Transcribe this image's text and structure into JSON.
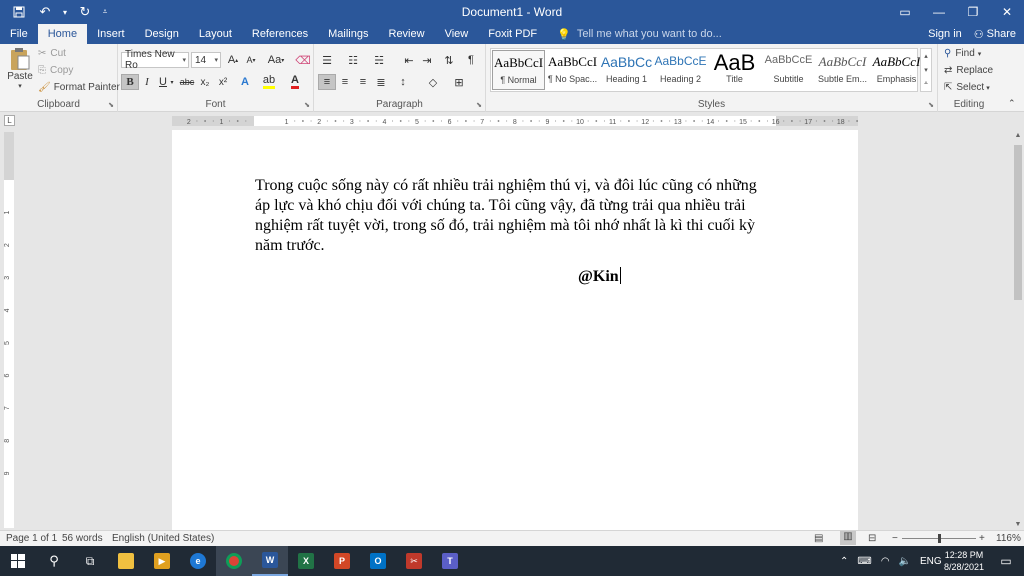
{
  "window": {
    "title": "Document1 - Word",
    "controls": {
      "ribbon_display": "▭",
      "minimize": "—",
      "restore": "❐",
      "close": "✕"
    }
  },
  "qat": {
    "save": "save-icon",
    "undo": "undo-icon",
    "redo": "repeat-icon"
  },
  "tabs": [
    {
      "label": "File",
      "active": false
    },
    {
      "label": "Home",
      "active": true
    },
    {
      "label": "Insert",
      "active": false
    },
    {
      "label": "Design",
      "active": false
    },
    {
      "label": "Layout",
      "active": false
    },
    {
      "label": "References",
      "active": false
    },
    {
      "label": "Mailings",
      "active": false
    },
    {
      "label": "Review",
      "active": false
    },
    {
      "label": "View",
      "active": false
    },
    {
      "label": "Foxit PDF",
      "active": false
    }
  ],
  "tellme": {
    "text": "Tell me what you want to do..."
  },
  "account": {
    "sign_in": "Sign in",
    "share": "Share"
  },
  "clipboard": {
    "paste": "Paste",
    "cut": "Cut",
    "copy": "Copy",
    "format_painter": "Format Painter",
    "label": "Clipboard"
  },
  "font": {
    "name": "Times New Ro",
    "size": "14",
    "grow": "A",
    "shrink": "A",
    "case": "Aa",
    "bold": "B",
    "italic": "I",
    "underline": "U",
    "strike": "abc",
    "sub": "x₂",
    "sup": "x²",
    "label": "Font"
  },
  "paragraph": {
    "label": "Paragraph",
    "show_marks": "¶"
  },
  "styles": {
    "label": "Styles",
    "items": [
      {
        "sample": "AaBbCcI",
        "name": "¶ Normal"
      },
      {
        "sample": "AaBbCcI",
        "name": "¶ No Spac..."
      },
      {
        "sample": "AaBbCc",
        "name": "Heading 1"
      },
      {
        "sample": "AaBbCcE",
        "name": "Heading 2"
      },
      {
        "sample": "AaB",
        "name": "Title"
      },
      {
        "sample": "AaBbCcE",
        "name": "Subtitle"
      },
      {
        "sample": "AaBbCcI",
        "name": "Subtle Em..."
      },
      {
        "sample": "AaBbCcI",
        "name": "Emphasis"
      }
    ]
  },
  "editing": {
    "find": "Find",
    "replace": "Replace",
    "select": "Select",
    "label": "Editing"
  },
  "ruler": {
    "h_labels": [
      "2",
      "1",
      "1",
      "2",
      "3",
      "4",
      "5",
      "6",
      "7",
      "8",
      "9",
      "10",
      "11",
      "12",
      "13",
      "14",
      "15",
      "16",
      "17",
      "18"
    ],
    "v_labels": [
      "1",
      "2",
      "3",
      "4",
      "5",
      "6",
      "7",
      "8",
      "9"
    ]
  },
  "document": {
    "paragraph": "Trong cuộc sống này có rất nhiều trải nghiệm thú vị, và đôi lúc cũng có những áp lực và khó chịu đối với chúng ta. Tôi cũng vậy, đã từng trải qua nhiều trải nghiệm rất tuyệt vời, trong số đó, trải nghiệm mà tôi nhớ nhất là kì thi cuối kỳ năm trước.",
    "signature": "@Kin"
  },
  "status": {
    "page": "Page 1 of 1",
    "words": "56 words",
    "language": "English (United States)",
    "zoom": "116%",
    "zoom_minus": "−",
    "zoom_plus": "+"
  },
  "taskbar": {
    "language": "ENG",
    "time": "12:28 PM",
    "date": "8/28/2021"
  }
}
